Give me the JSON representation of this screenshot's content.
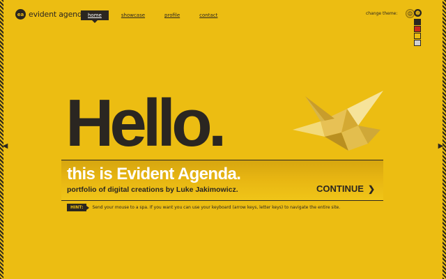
{
  "logo": {
    "badge": "ea",
    "text": "evident agenda"
  },
  "nav": {
    "items": [
      {
        "label": "home"
      },
      {
        "label": "showcase"
      },
      {
        "label": "profile"
      },
      {
        "label": "contact"
      }
    ],
    "active": "home"
  },
  "theme": {
    "label": "change theme:",
    "swatch_colors": [
      "#2b2620",
      "#c8281c",
      "#ecbd12",
      "#cfcfcf"
    ]
  },
  "hero": {
    "heading": "Hello.",
    "title": "this is Evident Agenda.",
    "subtitle": "portfolio of digital creations by Luke Jakimowicz.",
    "continue_label": "CONTINUE"
  },
  "hint": {
    "tag": "HINT:",
    "text": "Send your mouse to a spa. If you want you can use your keyboard (arrow keys, letter keys) to navigate the entire site."
  },
  "colors": {
    "background": "#ecbd12",
    "dark": "#2b2620",
    "light": "#ffffff"
  }
}
